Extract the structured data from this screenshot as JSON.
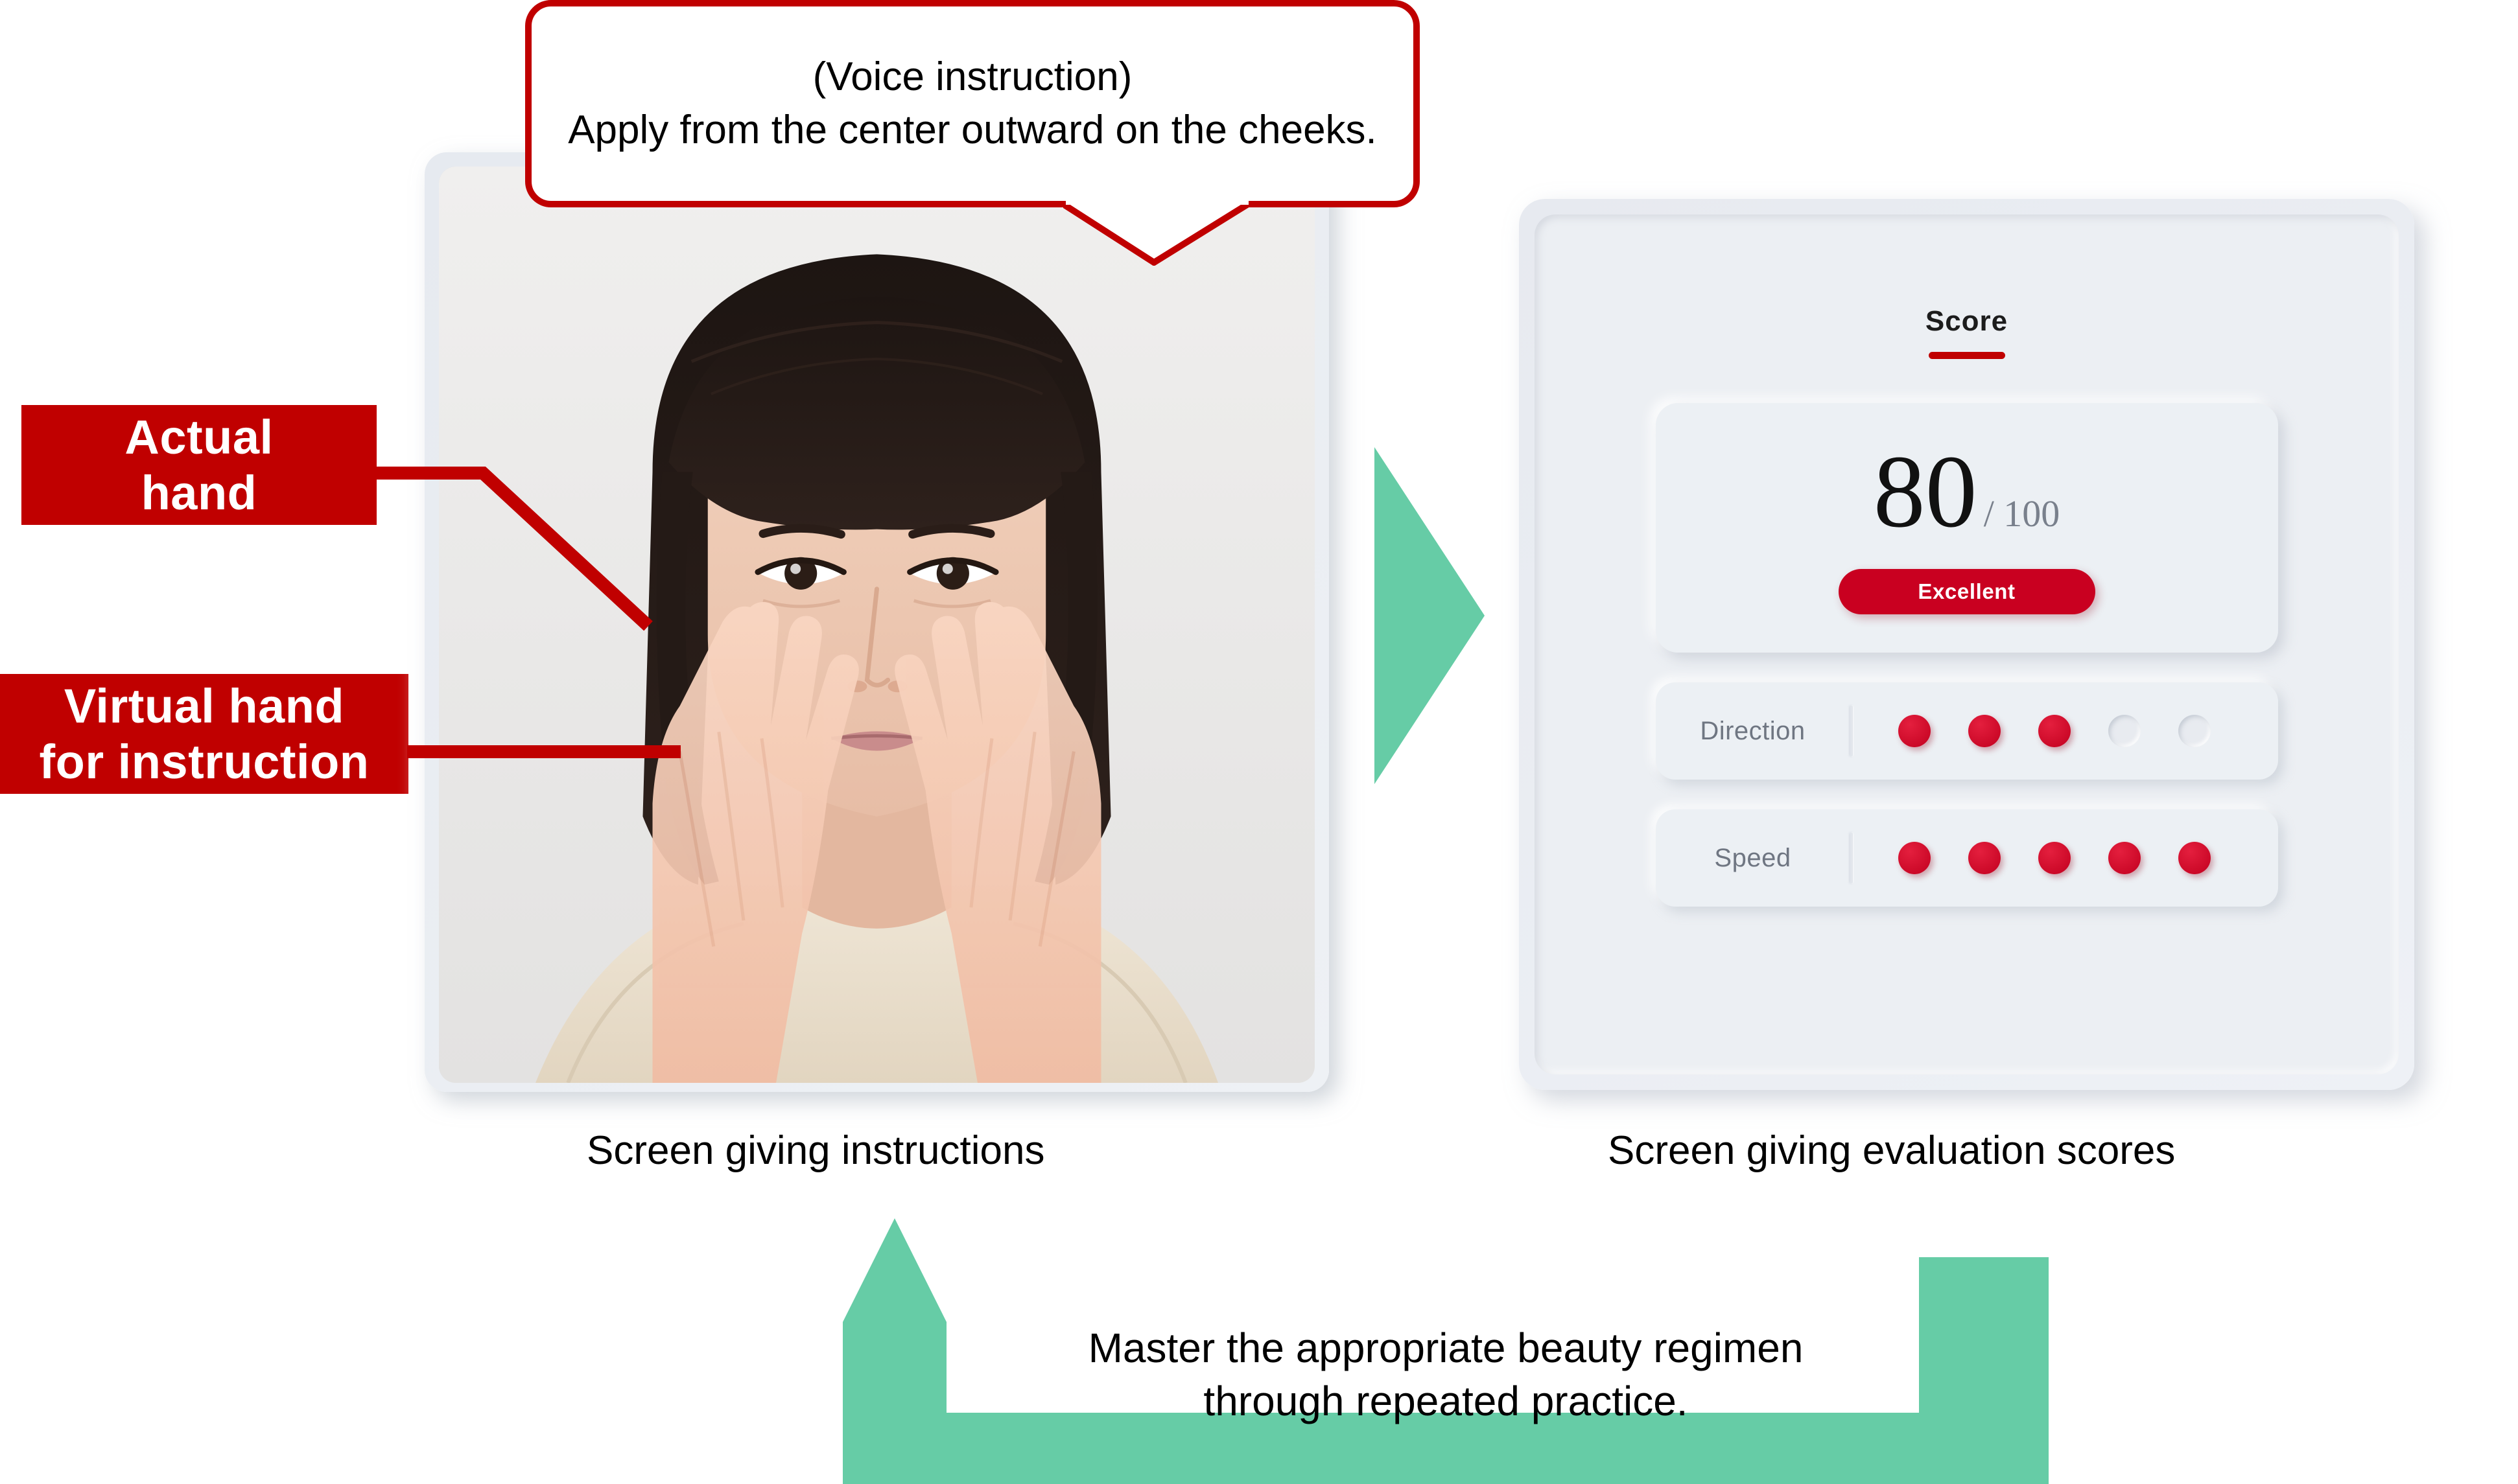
{
  "instruction_bubble": {
    "name": "voice-instruction-bubble",
    "text": "(Voice instruction)\nApply from the center outward on the cheeks."
  },
  "annotations": [
    {
      "id": "actual-hand",
      "label": "Actual\nhand"
    },
    {
      "id": "virtual-hand",
      "label": "Virtual hand\nfor instruction"
    }
  ],
  "captions": {
    "left": "Screen giving instructions",
    "right": "Screen giving evaluation scores"
  },
  "score_screen": {
    "title": "Score",
    "score_value": "80",
    "score_denominator": "/ 100",
    "verdict": "Excellent",
    "metrics": [
      {
        "label": "Direction",
        "filled": 3,
        "total": 5
      },
      {
        "label": "Speed",
        "filled": 5,
        "total": 5
      }
    ]
  },
  "loop_banner": {
    "text": "Master the appropriate beauty regimen\nthrough repeated practice."
  },
  "colors": {
    "red": "#C00000",
    "badge_red": "#C90020",
    "green": "#66CCA6",
    "panel": "#eceff3",
    "muted_text": "#6f7682"
  }
}
